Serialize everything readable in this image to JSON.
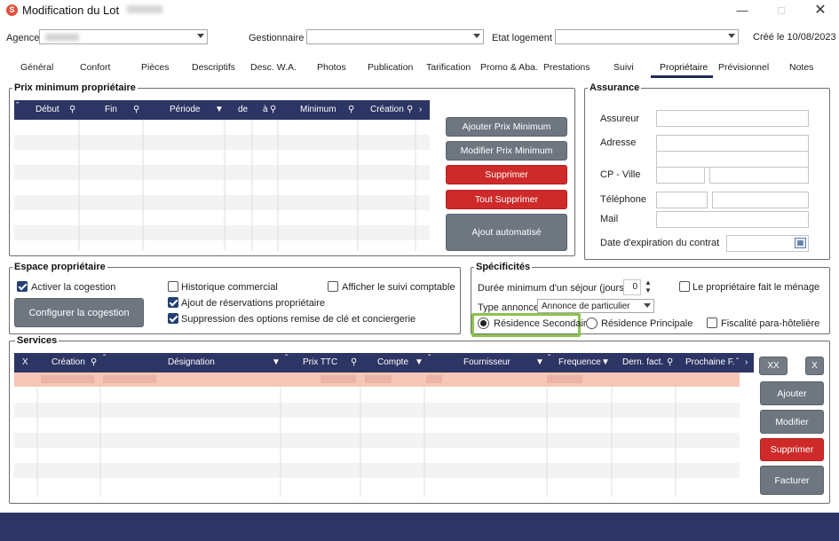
{
  "window": {
    "title": "Modification du Lot",
    "icon": "app-logo-icon"
  },
  "topbar": {
    "agence_label": "Agence",
    "gestionnaire_label": "Gestionnaire",
    "etat_label": "Etat logement",
    "created": "Créé le 10/08/2023"
  },
  "tabs": [
    "Général",
    "Confort",
    "Pièces",
    "Descriptifs",
    "Desc. W.A.",
    "Photos",
    "Publication",
    "Tarification",
    "Promo & Aba.",
    "Prestations",
    "Suivi",
    "Propriétaire",
    "Prévisionnel",
    "Notes"
  ],
  "active_tab": "Propriétaire",
  "prix": {
    "title": "Prix minimum propriétaire",
    "columns": [
      "Début",
      "Fin",
      "Période",
      "de",
      "à",
      "Minimum",
      "Création"
    ],
    "buttons": {
      "add": "Ajouter Prix Minimum",
      "edit": "Modifier Prix Minimum",
      "delete": "Supprimer",
      "delete_all": "Tout Supprimer",
      "auto": "Ajout automatisé"
    }
  },
  "assurance": {
    "title": "Assurance",
    "assureur": "Assureur",
    "adresse": "Adresse",
    "cp_ville": "CP - Ville",
    "telephone": "Téléphone",
    "mail": "Mail",
    "expiration": "Date d'expiration du contrat"
  },
  "espace": {
    "title": "Espace propriétaire",
    "activer": "Activer la cogestion",
    "historique": "Historique commercial",
    "afficher": "Afficher le suivi comptable",
    "ajout_resa": "Ajout de réservations propriétaire",
    "suppression": "Suppression des options remise de clé et conciergerie",
    "configurer": "Configurer la cogestion",
    "checks": {
      "activer": true,
      "historique": false,
      "afficher": false,
      "ajout_resa": true,
      "suppression": true
    }
  },
  "specificites": {
    "title": "Spécificités",
    "duree_label": "Durée minimum d'un séjour (jours)",
    "duree_value": "0",
    "menage": "Le propriétaire fait le ménage",
    "type_label": "Type annonce",
    "type_value": "Annonce de particulier",
    "res_secondaire": "Résidence Secondaire",
    "res_principale": "Résidence Principale",
    "fiscalite": "Fiscalité para-hôtelière",
    "selected_residence": "Résidence Secondaire",
    "highlight_color": "#8bc34a"
  },
  "services": {
    "title": "Services",
    "columns": [
      "X",
      "Création",
      "Désignation",
      "Prix TTC",
      "Compte",
      "Fournisseur",
      "Frequence",
      "Dern. fact.",
      "Prochaine F."
    ],
    "buttons": {
      "xx": "XX",
      "x": "X",
      "add": "Ajouter",
      "edit": "Modifier",
      "delete": "Supprimer",
      "bill": "Facturer"
    },
    "selected_row_color": "#f6c6b6"
  }
}
